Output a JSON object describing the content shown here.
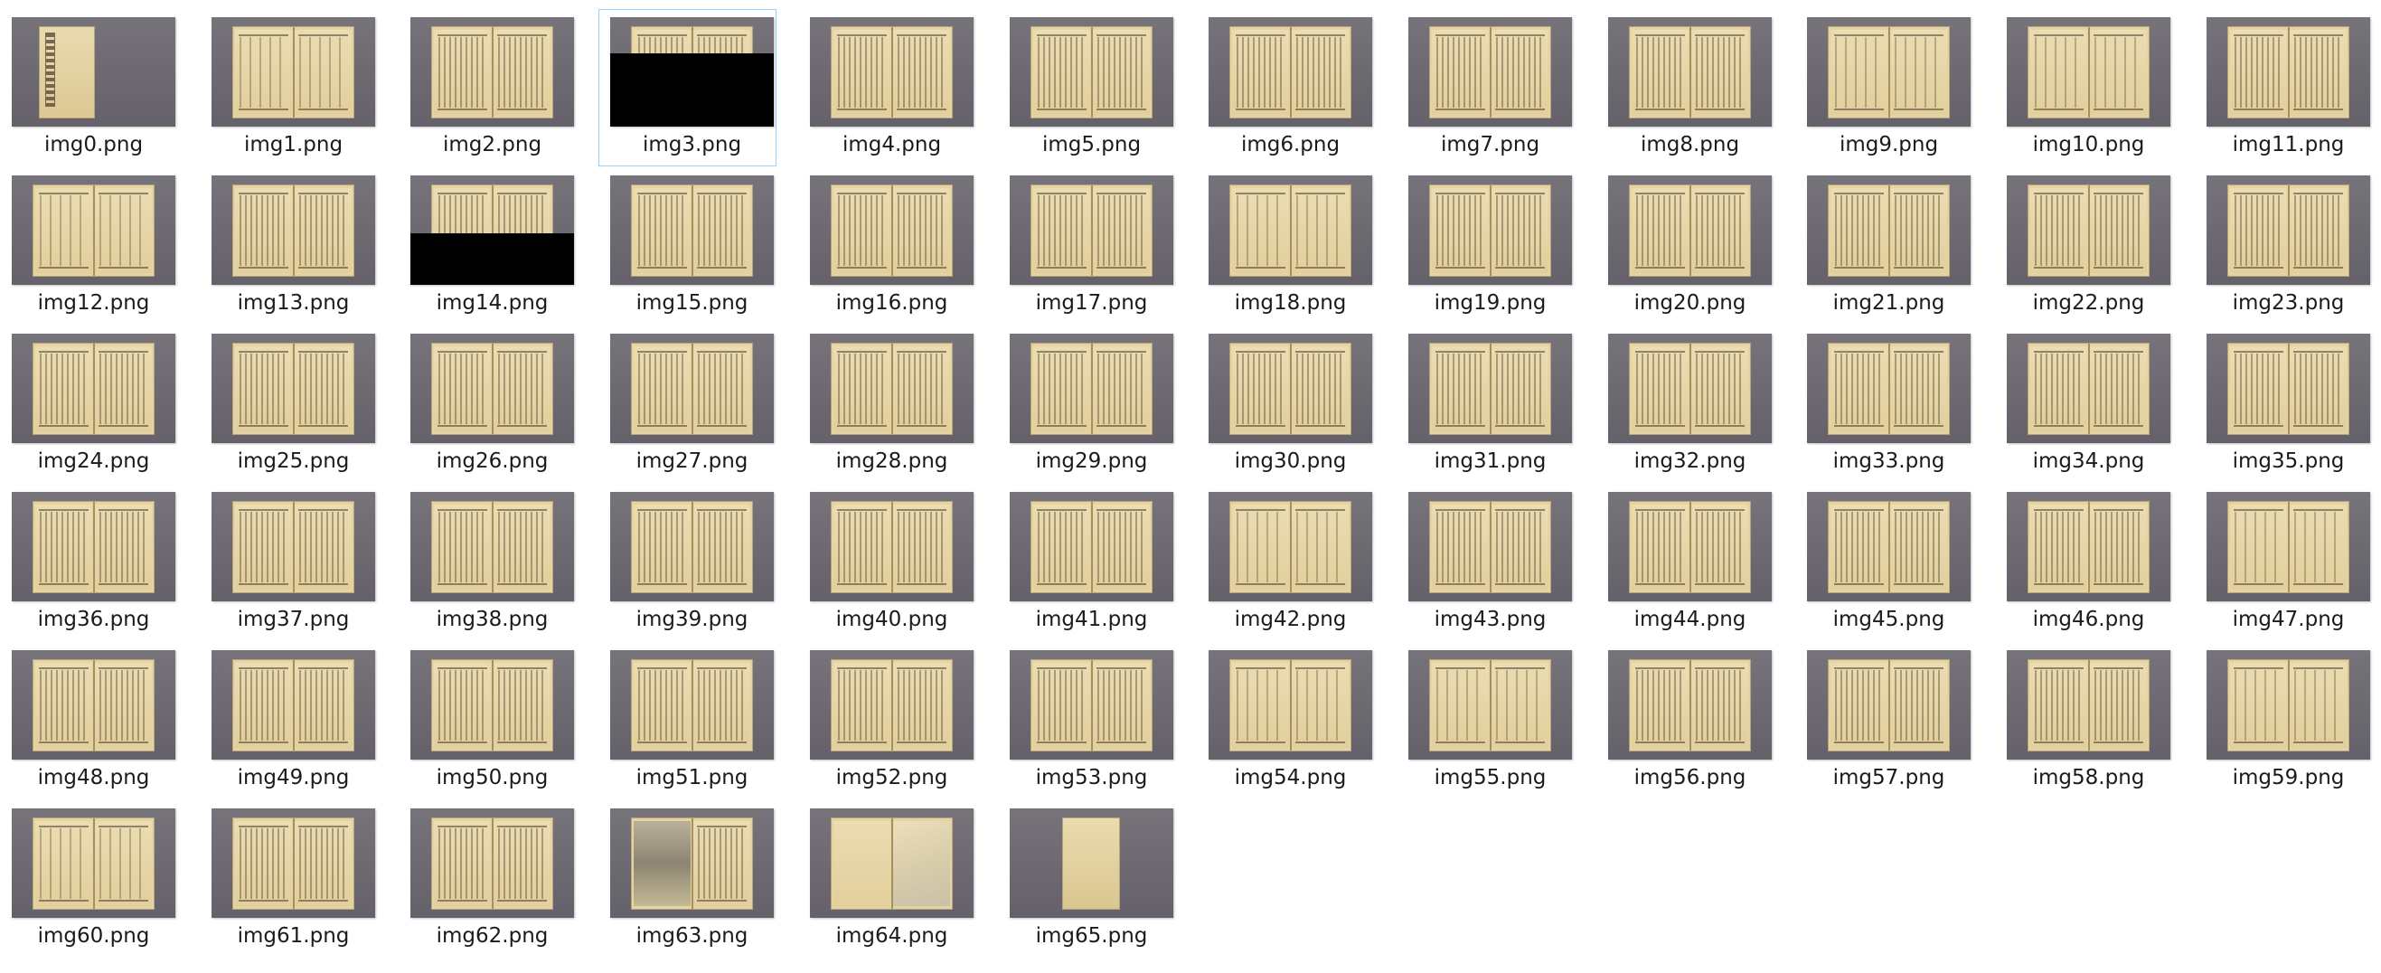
{
  "files": [
    {
      "name": "img0.png",
      "kind": "cover"
    },
    {
      "name": "img1.png",
      "kind": "sparse"
    },
    {
      "name": "img2.png",
      "kind": "spread"
    },
    {
      "name": "img3.png",
      "kind": "redacted",
      "selected": true
    },
    {
      "name": "img4.png",
      "kind": "spread"
    },
    {
      "name": "img5.png",
      "kind": "spread"
    },
    {
      "name": "img6.png",
      "kind": "spread"
    },
    {
      "name": "img7.png",
      "kind": "spread"
    },
    {
      "name": "img8.png",
      "kind": "spread"
    },
    {
      "name": "img9.png",
      "kind": "sparse"
    },
    {
      "name": "img10.png",
      "kind": "sparse"
    },
    {
      "name": "img11.png",
      "kind": "spread"
    },
    {
      "name": "img12.png",
      "kind": "sparse"
    },
    {
      "name": "img13.png",
      "kind": "spread"
    },
    {
      "name": "img14.png",
      "kind": "redacted"
    },
    {
      "name": "img15.png",
      "kind": "spread"
    },
    {
      "name": "img16.png",
      "kind": "spread"
    },
    {
      "name": "img17.png",
      "kind": "spread"
    },
    {
      "name": "img18.png",
      "kind": "sparse"
    },
    {
      "name": "img19.png",
      "kind": "spread"
    },
    {
      "name": "img20.png",
      "kind": "spread"
    },
    {
      "name": "img21.png",
      "kind": "spread"
    },
    {
      "name": "img22.png",
      "kind": "spread"
    },
    {
      "name": "img23.png",
      "kind": "spread"
    },
    {
      "name": "img24.png",
      "kind": "spread"
    },
    {
      "name": "img25.png",
      "kind": "spread"
    },
    {
      "name": "img26.png",
      "kind": "spread"
    },
    {
      "name": "img27.png",
      "kind": "spread"
    },
    {
      "name": "img28.png",
      "kind": "spread"
    },
    {
      "name": "img29.png",
      "kind": "spread"
    },
    {
      "name": "img30.png",
      "kind": "spread"
    },
    {
      "name": "img31.png",
      "kind": "spread"
    },
    {
      "name": "img32.png",
      "kind": "spread"
    },
    {
      "name": "img33.png",
      "kind": "spread"
    },
    {
      "name": "img34.png",
      "kind": "spread"
    },
    {
      "name": "img35.png",
      "kind": "spread"
    },
    {
      "name": "img36.png",
      "kind": "spread"
    },
    {
      "name": "img37.png",
      "kind": "spread"
    },
    {
      "name": "img38.png",
      "kind": "spread"
    },
    {
      "name": "img39.png",
      "kind": "spread"
    },
    {
      "name": "img40.png",
      "kind": "spread"
    },
    {
      "name": "img41.png",
      "kind": "spread"
    },
    {
      "name": "img42.png",
      "kind": "sparse"
    },
    {
      "name": "img43.png",
      "kind": "spread"
    },
    {
      "name": "img44.png",
      "kind": "spread"
    },
    {
      "name": "img45.png",
      "kind": "spread"
    },
    {
      "name": "img46.png",
      "kind": "spread"
    },
    {
      "name": "img47.png",
      "kind": "sparse"
    },
    {
      "name": "img48.png",
      "kind": "spread"
    },
    {
      "name": "img49.png",
      "kind": "spread"
    },
    {
      "name": "img50.png",
      "kind": "spread"
    },
    {
      "name": "img51.png",
      "kind": "spread"
    },
    {
      "name": "img52.png",
      "kind": "spread"
    },
    {
      "name": "img53.png",
      "kind": "spread"
    },
    {
      "name": "img54.png",
      "kind": "sparse"
    },
    {
      "name": "img55.png",
      "kind": "sparse"
    },
    {
      "name": "img56.png",
      "kind": "spread"
    },
    {
      "name": "img57.png",
      "kind": "spread"
    },
    {
      "name": "img58.png",
      "kind": "spread"
    },
    {
      "name": "img59.png",
      "kind": "sparse"
    },
    {
      "name": "img60.png",
      "kind": "sparse"
    },
    {
      "name": "img61.png",
      "kind": "spread"
    },
    {
      "name": "img62.png",
      "kind": "spread"
    },
    {
      "name": "img63.png",
      "kind": "illustration"
    },
    {
      "name": "img64.png",
      "kind": "illustration-blank"
    },
    {
      "name": "img65.png",
      "kind": "single"
    }
  ],
  "redaction_fraction": {
    "img3.png": 0.67,
    "img14.png": 0.47
  },
  "colors": {
    "selection_border": "#99d1ff",
    "thumbnail_background": "#6e6a70",
    "page_color": "#e4d3a4",
    "caption_color": "#1b1b1b"
  }
}
